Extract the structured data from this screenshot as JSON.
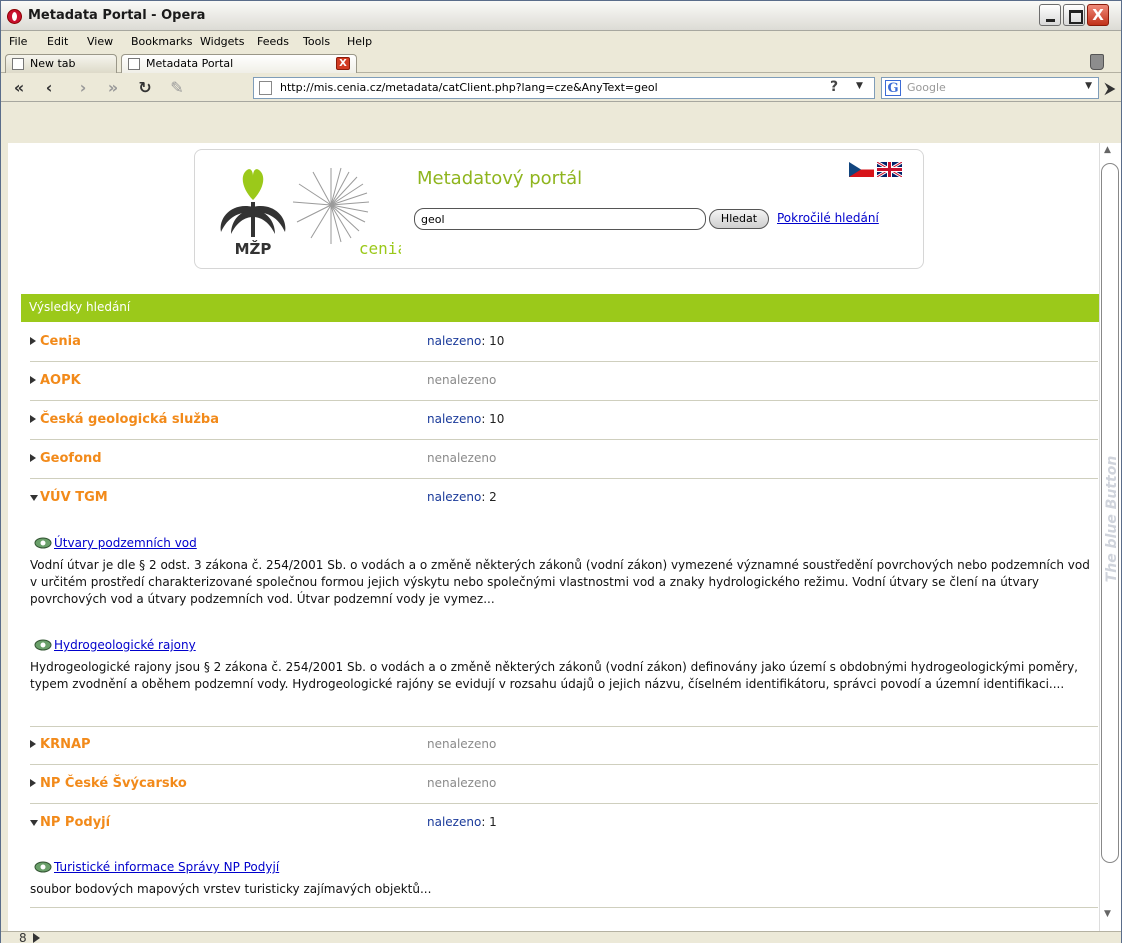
{
  "window": {
    "title": "Metadata Portal - Opera",
    "close_glyph": "X"
  },
  "menu": [
    "File",
    "Edit",
    "View",
    "Bookmarks",
    "Widgets",
    "Feeds",
    "Tools",
    "Help"
  ],
  "tabs": [
    {
      "label": "New tab"
    },
    {
      "label": "Metadata Portal",
      "active": true
    }
  ],
  "nav": {
    "rewind": "«",
    "back": "‹",
    "forward": "›",
    "fastforward": "»",
    "reload": "↻",
    "edit": "✎",
    "address": "http://mis.cenia.cz/metadata/catClient.php?lang=cze&AnyText=geol",
    "help_glyph": "?",
    "search_engine_letter": "G",
    "search_placeholder": "Google",
    "go_glyph": "⮞"
  },
  "sidebar_label": "The blue Button",
  "portal": {
    "title": "Metadatový portál",
    "search_value": "geol",
    "search_button": "Hledat",
    "advanced_link": "Pokročilé hledání",
    "logo_left_text": "MŽP",
    "logo_right_text": "cenia"
  },
  "results_header": "Výsledky hledání",
  "found_label": "nalezeno",
  "notfound_label": "nenalezeno",
  "providers": [
    {
      "name": "Cenia",
      "found": true,
      "count": ": 10"
    },
    {
      "name": "AOPK",
      "found": false
    },
    {
      "name": "Česká geologická služba",
      "found": true,
      "count": ": 10"
    },
    {
      "name": "Geofond",
      "found": false
    },
    {
      "name": "VÚV TGM",
      "found": true,
      "count": ": 2",
      "expanded": true
    },
    {
      "name": "KRNAP",
      "found": false
    },
    {
      "name": "NP České Švýcarsko",
      "found": false
    },
    {
      "name": "NP Podyjí",
      "found": true,
      "count": ": 1",
      "expanded": true
    }
  ],
  "records": [
    {
      "title": "Útvary podzemních vod",
      "description": "Vodní útvar je dle § 2 odst. 3 zákona č. 254/2001 Sb. o vodách a o změně některých zákonů (vodní zákon) vymezené významné soustředění povrchových nebo podzemních vod v určitém prostředí charakterizované společnou formou jejich výskytu nebo společnými vlastnostmi vod a znaky hydrologického režimu. Vodní útvary se člení na útvary povrchových vod a útvary podzemních vod. Útvar podzemní vody je vymez..."
    },
    {
      "title": "Hydrogeologické rajony",
      "description": "Hydrogeologické rajony jsou § 2 zákona č. 254/2001 Sb. o vodách a o změně některých zákonů (vodní zákon) definovány jako území s obdobnými hydrogeologickými poměry, typem zvodnění a oběhem podzemní vody. Hydrogeologické rajóny se evidují v rozsahu údajů o jejich názvu, číselném identifikátoru, správci povodí a územní identifikaci...."
    },
    {
      "title": "Turistické informace Správy NP Podyjí",
      "description": "soubor bodových mapových vrstev turisticky zajímavých objektů..."
    }
  ],
  "colors": {
    "accent_green": "#9bc91a",
    "provider_orange": "#f28a1a",
    "title_green": "#8fb51e",
    "link_blue": "#0000cc"
  }
}
